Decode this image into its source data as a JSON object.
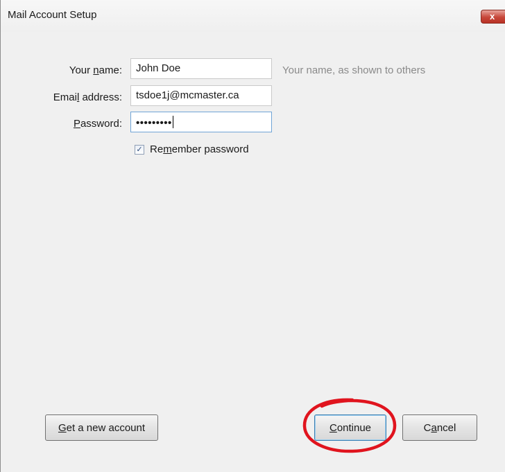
{
  "window": {
    "title": "Mail Account Setup",
    "close_glyph": "x"
  },
  "form": {
    "name_label": {
      "pre": "Your ",
      "key": "n",
      "post": "ame:"
    },
    "name_value": "John Doe",
    "name_hint": "Your name, as shown to others",
    "email_label": {
      "pre": "Emai",
      "key": "l",
      "post": " address:"
    },
    "email_value": "tsdoe1j@mcmaster.ca",
    "password_label": {
      "pre": "",
      "key": "P",
      "post": "assword:"
    },
    "password_value": "•••••••••",
    "remember": {
      "checked": true,
      "check_glyph": "✓",
      "label": {
        "pre": "Re",
        "key": "m",
        "post": "ember password"
      }
    }
  },
  "buttons": {
    "get_new_account": {
      "pre": "",
      "key": "G",
      "post": "et a new account"
    },
    "continue": {
      "pre": "",
      "key": "C",
      "post": "ontinue"
    },
    "cancel": {
      "pre": "C",
      "key": "a",
      "post": "ncel"
    }
  },
  "annotation": {
    "color": "#e0141e"
  },
  "colors": {
    "close_button": "#c7473a",
    "dialog_bg": "#f0f0f0"
  }
}
